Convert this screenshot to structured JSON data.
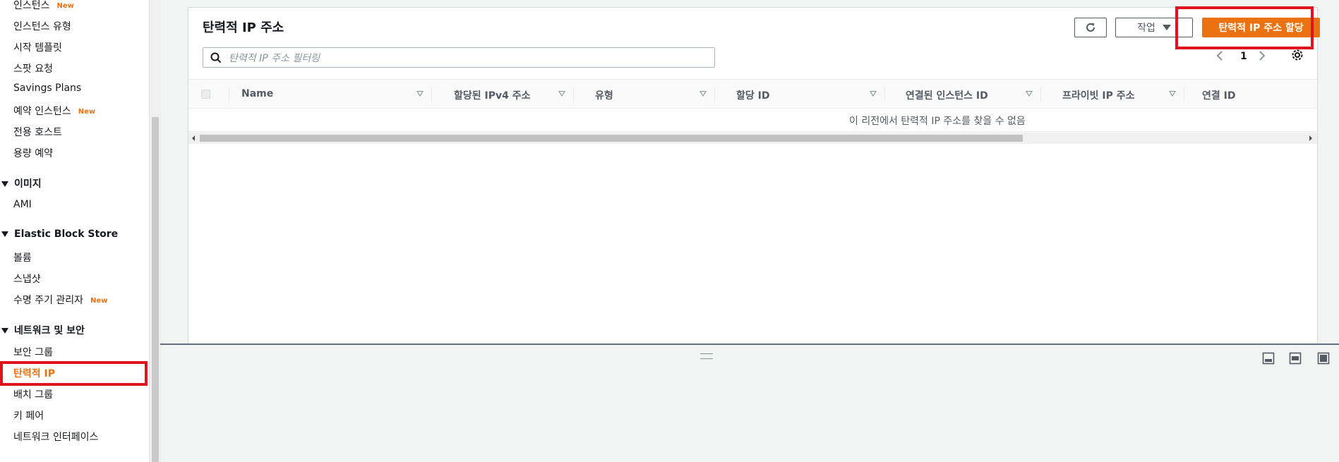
{
  "sidebar": {
    "items": [
      {
        "label": "인스턴스",
        "badge": "New"
      },
      {
        "label": "인스턴스 유형",
        "badge": ""
      },
      {
        "label": "시작 템플릿",
        "badge": ""
      },
      {
        "label": "스팟 요청",
        "badge": ""
      },
      {
        "label": "Savings Plans",
        "badge": ""
      },
      {
        "label": "예약 인스턴스",
        "badge": "New"
      },
      {
        "label": "전용 호스트",
        "badge": ""
      },
      {
        "label": "용량 예약",
        "badge": ""
      }
    ],
    "section_images": {
      "title": "이미지",
      "items": [
        {
          "label": "AMI"
        }
      ]
    },
    "section_ebs": {
      "title": "Elastic Block Store",
      "items": [
        {
          "label": "볼륨",
          "badge": ""
        },
        {
          "label": "스냅샷",
          "badge": ""
        },
        {
          "label": "수명 주기 관리자",
          "badge": "New"
        }
      ]
    },
    "section_network": {
      "title": "네트워크 및 보안",
      "items": [
        {
          "label": "보안 그룹"
        },
        {
          "label": "탄력적 IP"
        },
        {
          "label": "배치 그룹"
        },
        {
          "label": "키 페어"
        },
        {
          "label": "네트워크 인터페이스"
        }
      ]
    }
  },
  "panel": {
    "title": "탄력적 IP 주소",
    "actions_label": "작업",
    "allocate_label": "탄력적 IP 주소 할당",
    "search_placeholder": "탄력적 IP 주소 필터링",
    "page": "1",
    "columns": [
      "Name",
      "할당된 IPv4 주소",
      "유형",
      "할당 ID",
      "연결된 인스턴스 ID",
      "프라이빗 IP 주소",
      "연결 ID"
    ],
    "empty_message": "이 리전에서 탄력적 IP 주소를 찾을 수 없음"
  },
  "colors": {
    "accent": "#ec7211",
    "highlight": "#e0141e"
  },
  "icons": {
    "refresh": "refresh-icon",
    "search": "search-icon",
    "settings": "gear-icon",
    "prev": "chevron-left-icon",
    "next": "chevron-right-icon"
  }
}
